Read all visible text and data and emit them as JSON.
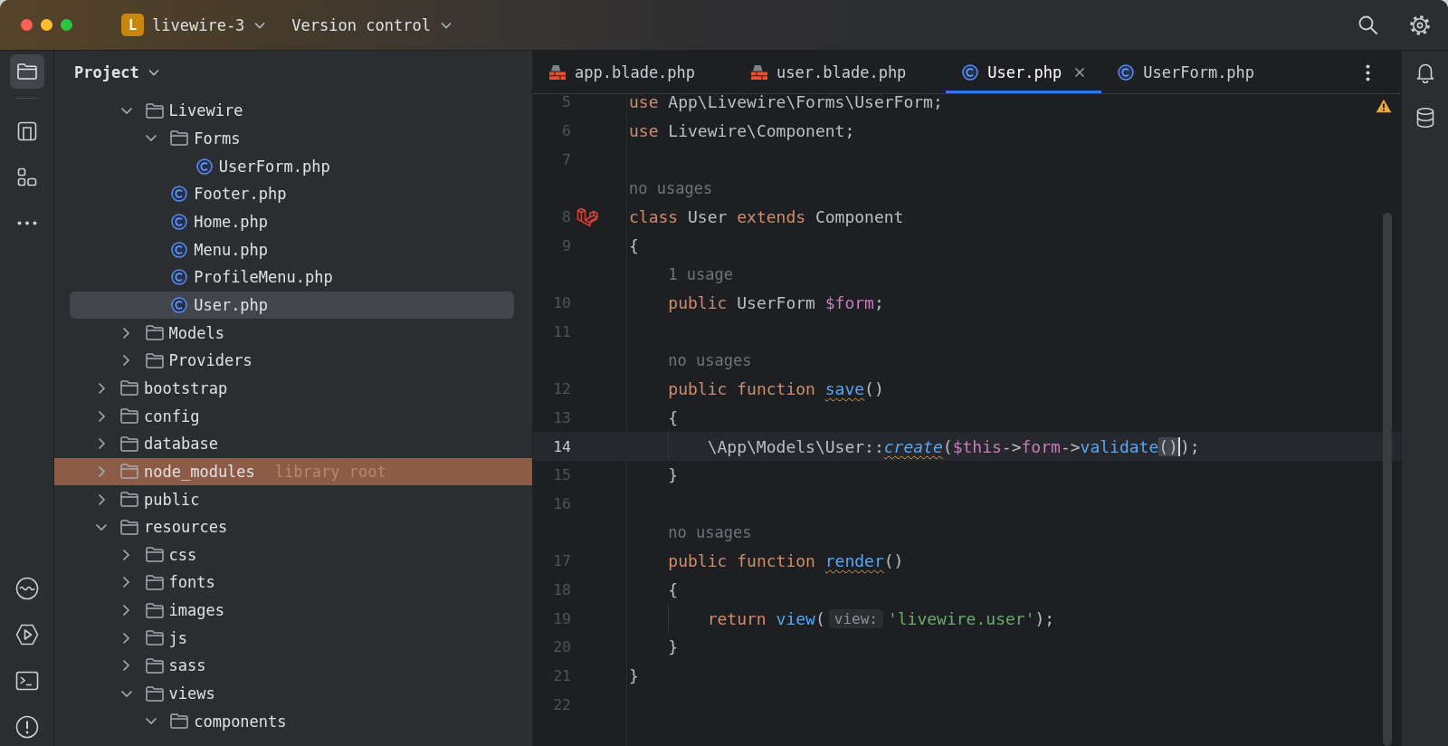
{
  "window": {
    "badge": "L",
    "project": "livewire-3",
    "vcs_menu": "Version control"
  },
  "left_toolbar": [
    {
      "selected": true
    },
    {
      "selected": false
    },
    {
      "selected": false
    }
  ],
  "project_panel": {
    "title": "Project",
    "tree": {
      "items_under_scrolled_parent": [
        {
          "label": "Livewire",
          "kind": "folder",
          "expanded": true,
          "selected": false,
          "children": [
            {
              "label": "Forms",
              "kind": "folder",
              "expanded": true,
              "selected": false,
              "children": [
                {
                  "label": "UserForm.php",
                  "kind": "class",
                  "selected": false
                }
              ]
            },
            {
              "label": "Footer.php",
              "kind": "class",
              "selected": false
            },
            {
              "label": "Home.php",
              "kind": "class",
              "selected": false
            },
            {
              "label": "Menu.php",
              "kind": "class",
              "selected": false
            },
            {
              "label": "ProfileMenu.php",
              "kind": "class",
              "selected": false
            },
            {
              "label": "User.php",
              "kind": "class",
              "selected": true
            }
          ]
        },
        {
          "label": "Models",
          "kind": "folder",
          "expanded": false,
          "selected": false
        },
        {
          "label": "Providers",
          "kind": "folder",
          "expanded": false,
          "selected": false
        }
      ],
      "items": [
        {
          "label": "bootstrap",
          "kind": "folder",
          "expanded": false,
          "selected": false
        },
        {
          "label": "config",
          "kind": "folder",
          "expanded": false,
          "selected": false
        },
        {
          "label": "database",
          "kind": "folder",
          "expanded": false,
          "selected": false
        },
        {
          "label": "node_modules",
          "kind": "folder",
          "expanded": false,
          "selected": false,
          "color": "#8d5c46",
          "note": "library root"
        },
        {
          "label": "public",
          "kind": "folder",
          "expanded": false,
          "selected": false
        },
        {
          "label": "resources",
          "kind": "folder",
          "expanded": true,
          "selected": false,
          "children": [
            {
              "label": "css",
              "kind": "folder",
              "expanded": false,
              "selected": false
            },
            {
              "label": "fonts",
              "kind": "folder",
              "expanded": false,
              "selected": false
            },
            {
              "label": "images",
              "kind": "folder",
              "expanded": false,
              "selected": false
            },
            {
              "label": "js",
              "kind": "folder",
              "expanded": false,
              "selected": false
            },
            {
              "label": "sass",
              "kind": "folder",
              "expanded": false,
              "selected": false
            },
            {
              "label": "views",
              "kind": "folder",
              "expanded": true,
              "selected": false,
              "children": [
                {
                  "label": "components",
                  "kind": "folder",
                  "expanded": true,
                  "selected": false
                }
              ]
            }
          ]
        }
      ]
    }
  },
  "editor": {
    "tabs": [
      {
        "label": "app.blade.php",
        "kind": "blade",
        "selected": false
      },
      {
        "label": "user.blade.php",
        "kind": "blade",
        "selected": false
      },
      {
        "label": "User.php",
        "kind": "class",
        "selected": true
      },
      {
        "label": "UserForm.php",
        "kind": "class",
        "selected": false
      }
    ],
    "warning": true,
    "lines": [
      {
        "kind": "code",
        "number": "5",
        "current": false,
        "gutter_icon": false,
        "tokens": [
          {
            "kind": "keyword",
            "text": "use"
          },
          {
            "kind": "plain",
            "text": " App\\Livewire\\Forms\\UserForm;"
          }
        ]
      },
      {
        "kind": "code",
        "number": "6",
        "current": false,
        "gutter_icon": false,
        "tokens": [
          {
            "kind": "keyword",
            "text": "use"
          },
          {
            "kind": "plain",
            "text": " Livewire\\Component;"
          }
        ]
      },
      {
        "kind": "code",
        "number": "7",
        "current": false,
        "gutter_icon": false
      },
      {
        "kind": "hint",
        "text": "no usages"
      },
      {
        "kind": "code",
        "number": "8",
        "current": false,
        "gutter_icon": true,
        "tokens": [
          {
            "kind": "keyword",
            "text": "class"
          },
          {
            "kind": "plain",
            "text": " User "
          },
          {
            "kind": "keyword",
            "text": "extends"
          },
          {
            "kind": "plain",
            "text": " Component"
          }
        ]
      },
      {
        "kind": "code",
        "number": "9",
        "current": false,
        "gutter_icon": false,
        "tokens": [
          {
            "kind": "plain",
            "text": "{"
          }
        ],
        "children": [
          {
            "kind": "hint",
            "text": "1 usage"
          },
          {
            "kind": "code",
            "number": "10",
            "current": false,
            "gutter_icon": false,
            "tokens": [
              {
                "kind": "keyword",
                "text": "public"
              },
              {
                "kind": "plain",
                "text": " UserForm "
              },
              {
                "kind": "variable",
                "text": "$form"
              },
              {
                "kind": "plain",
                "text": ";"
              }
            ]
          },
          {
            "kind": "code",
            "number": "11",
            "current": false,
            "gutter_icon": false
          },
          {
            "kind": "hint",
            "text": "no usages"
          },
          {
            "kind": "code",
            "number": "12",
            "current": false,
            "gutter_icon": false,
            "tokens": [
              {
                "kind": "keyword",
                "text": "public function "
              },
              {
                "kind": "declwarn",
                "text": "save"
              },
              {
                "kind": "plain",
                "text": "()"
              }
            ]
          },
          {
            "kind": "code",
            "number": "13",
            "current": false,
            "gutter_icon": false,
            "tokens": [
              {
                "kind": "plain",
                "text": "{"
              }
            ],
            "children": [
              {
                "kind": "code",
                "number": "14",
                "current": true,
                "gutter_icon": false,
                "tokens": [
                  {
                    "kind": "plain",
                    "text": "\\App\\Models\\User::"
                  },
                  {
                    "kind": "staticwarn",
                    "text": "create"
                  },
                  {
                    "kind": "plain",
                    "text": "("
                  },
                  {
                    "kind": "variable",
                    "text": "$this"
                  },
                  {
                    "kind": "plain",
                    "text": "->"
                  },
                  {
                    "kind": "member",
                    "text": "form"
                  },
                  {
                    "kind": "plain",
                    "text": "->"
                  },
                  {
                    "kind": "call",
                    "text": "validate"
                  },
                  {
                    "kind": "brace",
                    "text": "()"
                  },
                  {
                    "kind": "caret"
                  },
                  {
                    "kind": "plain",
                    "text": ");"
                  }
                ]
              }
            ]
          },
          {
            "kind": "code",
            "number": "15",
            "current": false,
            "gutter_icon": false,
            "tokens": [
              {
                "kind": "plain",
                "text": "}"
              }
            ]
          },
          {
            "kind": "code",
            "number": "16",
            "current": false,
            "gutter_icon": false
          },
          {
            "kind": "hint",
            "text": "no usages"
          },
          {
            "kind": "code",
            "number": "17",
            "current": false,
            "gutter_icon": false,
            "tokens": [
              {
                "kind": "keyword",
                "text": "public function "
              },
              {
                "kind": "declwarn",
                "text": "render"
              },
              {
                "kind": "plain",
                "text": "()"
              }
            ]
          },
          {
            "kind": "code",
            "number": "18",
            "current": false,
            "gutter_icon": false,
            "tokens": [
              {
                "kind": "plain",
                "text": "{"
              }
            ],
            "children": [
              {
                "kind": "code",
                "number": "19",
                "current": false,
                "gutter_icon": false,
                "tokens": [
                  {
                    "kind": "keyword",
                    "text": "return "
                  },
                  {
                    "kind": "call",
                    "text": "view"
                  },
                  {
                    "kind": "plain",
                    "text": "("
                  },
                  {
                    "kind": "inlay",
                    "text": "view:"
                  },
                  {
                    "kind": "string",
                    "text": "'livewire.user'"
                  },
                  {
                    "kind": "plain",
                    "text": ");"
                  }
                ]
              }
            ]
          },
          {
            "kind": "code",
            "number": "20",
            "current": false,
            "gutter_icon": false,
            "tokens": [
              {
                "kind": "plain",
                "text": "}"
              }
            ]
          }
        ]
      },
      {
        "kind": "code",
        "number": "21",
        "current": false,
        "gutter_icon": false,
        "tokens": [
          {
            "kind": "plain",
            "text": "}"
          }
        ]
      },
      {
        "kind": "code",
        "number": "22",
        "current": false,
        "gutter_icon": false
      }
    ]
  }
}
